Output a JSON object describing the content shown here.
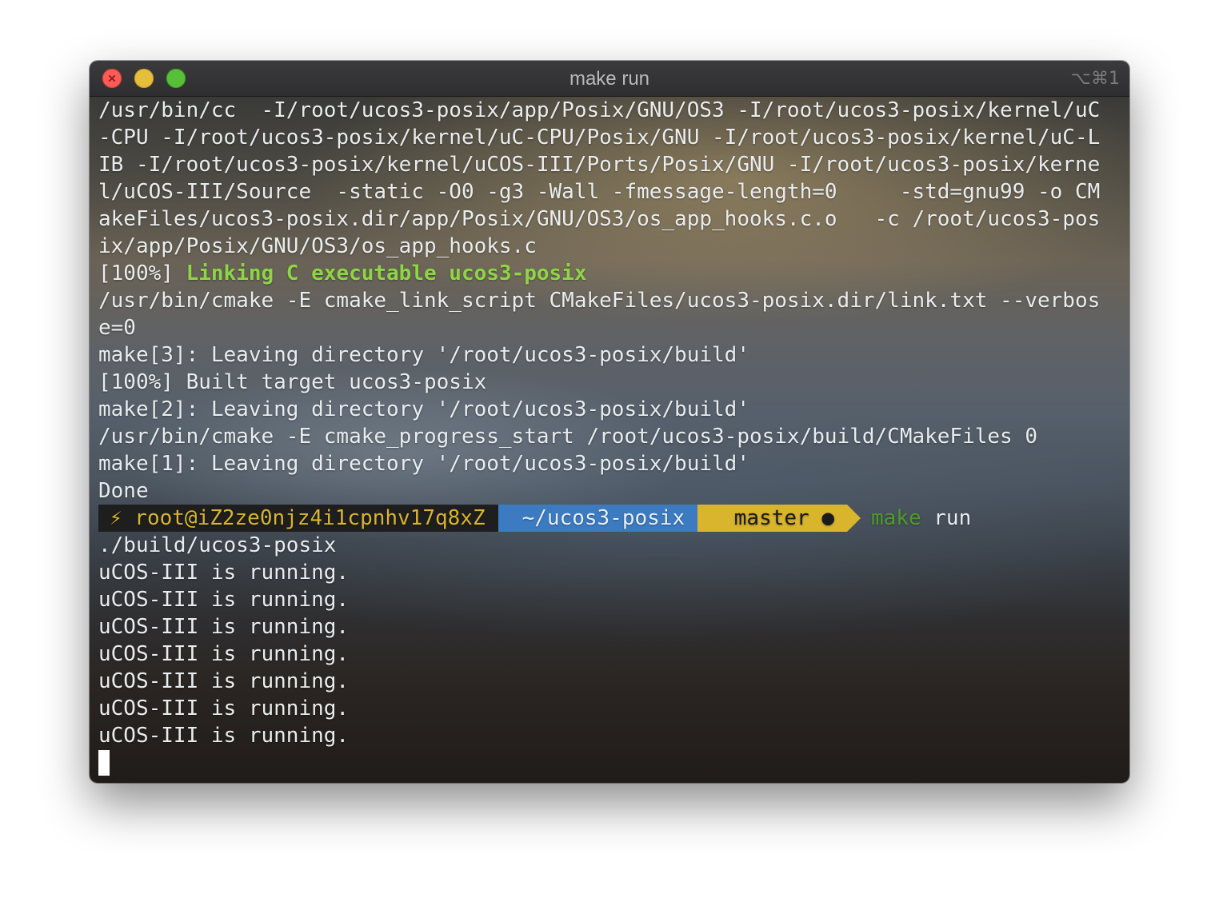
{
  "window": {
    "title": "make run",
    "shortcut": "⌥⌘1"
  },
  "output_before": [
    "/usr/bin/cc  -I/root/ucos3-posix/app/Posix/GNU/OS3 -I/root/ucos3-posix/kernel/uC",
    "-CPU -I/root/ucos3-posix/kernel/uC-CPU/Posix/GNU -I/root/ucos3-posix/kernel/uC-L",
    "IB -I/root/ucos3-posix/kernel/uCOS-III/Ports/Posix/GNU -I/root/ucos3-posix/kerne",
    "l/uCOS-III/Source  -static -O0 -g3 -Wall -fmessage-length=0     -std=gnu99 -o CM",
    "akeFiles/ucos3-posix.dir/app/Posix/GNU/OS3/os_app_hooks.c.o   -c /root/ucos3-pos",
    "ix/app/Posix/GNU/OS3/os_app_hooks.c"
  ],
  "linking": {
    "percent": "[100%]",
    "message": "Linking C executable ucos3-posix"
  },
  "output_after": [
    "/usr/bin/cmake -E cmake_link_script CMakeFiles/ucos3-posix.dir/link.txt --verbos",
    "e=0",
    "make[3]: Leaving directory '/root/ucos3-posix/build'",
    "[100%] Built target ucos3-posix",
    "make[2]: Leaving directory '/root/ucos3-posix/build'",
    "/usr/bin/cmake -E cmake_progress_start /root/ucos3-posix/build/CMakeFiles 0",
    "make[1]: Leaving directory '/root/ucos3-posix/build'",
    "Done"
  ],
  "prompt": {
    "user_segment": "⚡ root@iZ2ze0njz4i1cpnhv17q8xZ",
    "dir_segment": "~/ucos3-posix",
    "git_segment": " master ●",
    "command_word": "make",
    "command_arg": "run"
  },
  "run_output": [
    "./build/ucos3-posix",
    "uCOS-III is running.",
    "uCOS-III is running.",
    "uCOS-III is running.",
    "uCOS-III is running.",
    "uCOS-III is running.",
    "uCOS-III is running.",
    "uCOS-III is running."
  ],
  "colors": {
    "prompt_user_bg": "#1e1e1e",
    "prompt_user_fg": "#d9b42d",
    "prompt_dir_bg": "#3c7bc2",
    "prompt_git_bg": "#d9b42d",
    "linking_green": "#8ed545",
    "command_green": "#4f9a2a"
  }
}
